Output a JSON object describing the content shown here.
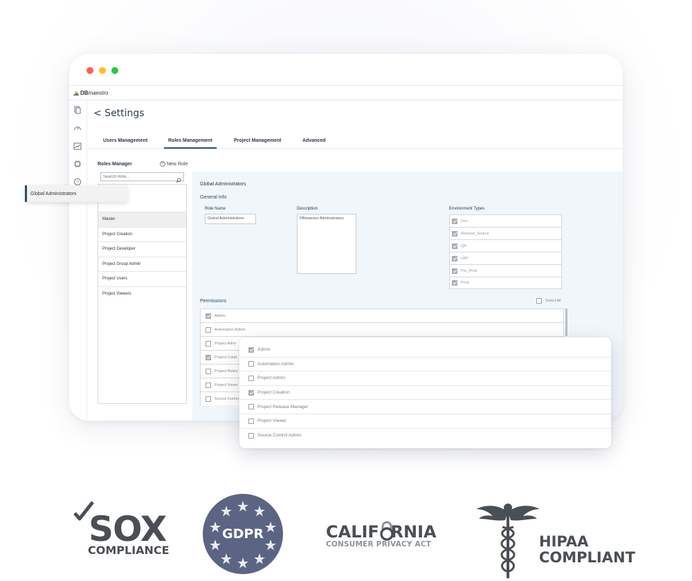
{
  "app": {
    "logo_bold": "DB",
    "logo_rest": "maestro"
  },
  "page": {
    "title": "< Settings"
  },
  "tabs": [
    {
      "label": "Users Management"
    },
    {
      "label": "Roles Management"
    },
    {
      "label": "Project Management"
    },
    {
      "label": "Advanced"
    }
  ],
  "roles_manager": {
    "title": "Roles Manager",
    "new_role": "New Role",
    "search_placeholder": "Search Role...",
    "selected": "Global Administrators",
    "items": [
      "Master",
      "Project Creation",
      "Project Developer",
      "Project Group Admin",
      "Project Users",
      "Project Viewers"
    ]
  },
  "detail": {
    "title": "Global Administrators",
    "general_info": "General Info",
    "role_name_label": "Role Name",
    "role_name_value": "Global Administrators",
    "description_label": "Description",
    "description_value": "DBmaestro Administrators",
    "env_label": "Environment Types",
    "environments": [
      {
        "name": "Dev",
        "checked": true
      },
      {
        "name": "Release_Source",
        "checked": true
      },
      {
        "name": "QA",
        "checked": true
      },
      {
        "name": "UAT",
        "checked": true
      },
      {
        "name": "Pre_Prod",
        "checked": true
      },
      {
        "name": "Prod",
        "checked": true
      }
    ],
    "permissions_label": "Permissions",
    "select_all": "Select All",
    "permissions": [
      {
        "name": "Admin",
        "checked": true
      },
      {
        "name": "Automation Admin",
        "checked": false
      },
      {
        "name": "Project Admi",
        "checked": false
      },
      {
        "name": "Project Creat",
        "checked": true
      },
      {
        "name": "Project Relea",
        "checked": false
      },
      {
        "name": "Project Viewe",
        "checked": false
      },
      {
        "name": "Source Contro",
        "checked": false
      }
    ]
  },
  "zoom_permissions": [
    {
      "name": "Admin",
      "checked": true
    },
    {
      "name": "Automation Admin",
      "checked": false
    },
    {
      "name": "Project Admin",
      "checked": false
    },
    {
      "name": "Project Creation",
      "checked": true
    },
    {
      "name": "Project Release Manager",
      "checked": false
    },
    {
      "name": "Project Viewer",
      "checked": false
    },
    {
      "name": "Source Control Admin",
      "checked": false
    }
  ],
  "badges": {
    "sox": {
      "main": "SOX",
      "sub": "COMPLIANCE"
    },
    "gdpr": {
      "main": "GDPR"
    },
    "california": {
      "main": "CALIF  RNIA",
      "sub": "CONSUMER PRIVACY ACT"
    },
    "hipaa": {
      "line1": "HIPAA",
      "line2": "COMPLIANT"
    }
  },
  "colors": {
    "accent": "#2b4c6a",
    "panel_bg": "#f1f6fb",
    "badge_gray": "#4a4e56",
    "gdpr_blue": "#5b6482"
  }
}
